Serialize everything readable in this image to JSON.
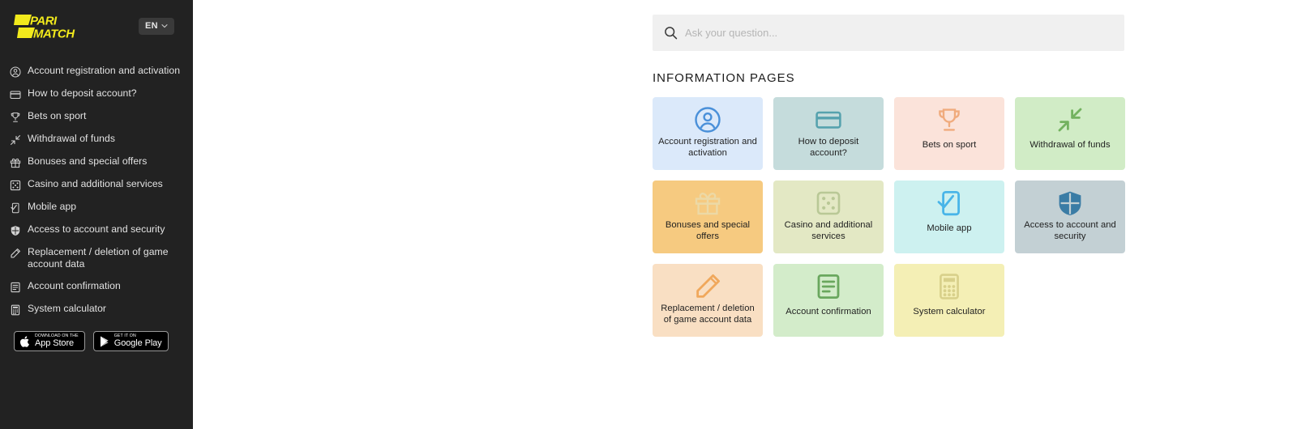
{
  "brand": {
    "name": "PARIMATCH",
    "line1": "PARI",
    "line2": "MATCH",
    "logo_color": "#f2ea1c"
  },
  "sidebar": {
    "language": {
      "label": "EN",
      "icon": "chevron-down-icon"
    },
    "items": [
      {
        "label": "Account registration and activation",
        "icon": "user-circle-icon"
      },
      {
        "label": "How to deposit account?",
        "icon": "credit-card-icon"
      },
      {
        "label": "Bets on sport",
        "icon": "trophy-icon"
      },
      {
        "label": "Withdrawal of funds",
        "icon": "arrows-in-icon"
      },
      {
        "label": "Bonuses and special offers",
        "icon": "gift-icon"
      },
      {
        "label": "Casino and additional services",
        "icon": "dice-icon"
      },
      {
        "label": "Mobile app",
        "icon": "mobile-check-icon"
      },
      {
        "label": "Access to account and security",
        "icon": "shield-icon"
      },
      {
        "label": "Replacement / deletion of game account data",
        "icon": "pencil-icon"
      },
      {
        "label": "Account confirmation",
        "icon": "document-icon"
      },
      {
        "label": "System calculator",
        "icon": "calculator-icon"
      }
    ],
    "store_badges": [
      {
        "top": "Download on the",
        "bottom": "App Store",
        "icon": "apple-icon"
      },
      {
        "top": "GET IT ON",
        "bottom": "Google Play",
        "icon": "google-play-icon"
      }
    ]
  },
  "search": {
    "placeholder": "Ask your question...",
    "value": "",
    "icon": "search-icon"
  },
  "main": {
    "section_title": "INFORMATION PAGES",
    "cards": [
      {
        "label": "Account registration and activation",
        "icon": "user-circle-icon",
        "bg": "#dbe9fa",
        "fg": "#4a90d9"
      },
      {
        "label": "How to deposit account?",
        "icon": "credit-card-icon",
        "bg": "#c5dcdc",
        "fg": "#56a2ae"
      },
      {
        "label": "Bets on sport",
        "icon": "trophy-icon",
        "bg": "#fbe3da",
        "fg": "#f0ab7d"
      },
      {
        "label": "Withdrawal of funds",
        "icon": "arrows-in-icon",
        "bg": "#d1ecc6",
        "fg": "#73b25f"
      },
      {
        "label": "Bonuses and special offers",
        "icon": "gift-icon",
        "bg": "#f6ca80",
        "fg": "#ecd9a6"
      },
      {
        "label": "Casino and additional services",
        "icon": "dice-icon",
        "bg": "#e3e8c4",
        "fg": "#b9c896"
      },
      {
        "label": "Mobile app",
        "icon": "mobile-check-icon",
        "bg": "#cdf1f0",
        "fg": "#49b5e8"
      },
      {
        "label": "Access to account and security",
        "icon": "shield-icon",
        "bg": "#c3d0d4",
        "fg": "#3a7ca5"
      },
      {
        "label": "Replacement / deletion of game account data",
        "icon": "pencil-icon",
        "bg": "#f9dfc3",
        "fg": "#f0a85c"
      },
      {
        "label": "Account confirmation",
        "icon": "document-icon",
        "bg": "#d3ecca",
        "fg": "#6aa75e"
      },
      {
        "label": "System calculator",
        "icon": "calculator-icon",
        "bg": "#f4efb5",
        "fg": "#d8d08a"
      }
    ]
  }
}
